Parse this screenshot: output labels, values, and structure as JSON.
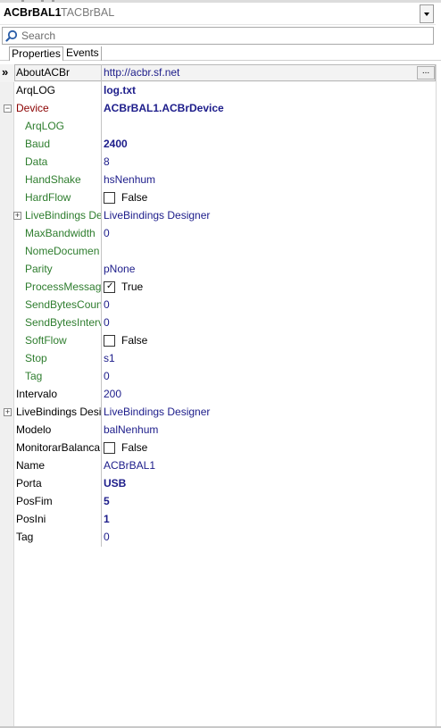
{
  "component": {
    "name": "ACBrBAL1",
    "type": "TACBrBAL"
  },
  "search": {
    "placeholder": "Search"
  },
  "tabs": {
    "properties": "Properties",
    "events": "Events"
  },
  "properties": {
    "about": {
      "name": "AboutACBr",
      "value": "http://acbr.sf.net"
    },
    "arqlog": {
      "name": "ArqLOG",
      "value": "log.txt"
    },
    "device": {
      "name": "Device",
      "value": "ACBrBAL1.ACBrDevice"
    },
    "dev_arqlog": {
      "name": "ArqLOG",
      "value": ""
    },
    "dev_baud": {
      "name": "Baud",
      "value": "2400"
    },
    "dev_data": {
      "name": "Data",
      "value": "8"
    },
    "dev_handshake": {
      "name": "HandShake",
      "value": "hsNenhum"
    },
    "dev_hardflow": {
      "name": "HardFlow",
      "value": "False",
      "checked": false
    },
    "dev_livebindings": {
      "name": "LiveBindings De",
      "value": "LiveBindings Designer"
    },
    "dev_maxbandwidth": {
      "name": "MaxBandwidth",
      "value": "0"
    },
    "dev_nomedocumento": {
      "name": "NomeDocumen",
      "value": ""
    },
    "dev_parity": {
      "name": "Parity",
      "value": "pNone"
    },
    "dev_processmessages": {
      "name": "ProcessMessage",
      "value": "True",
      "checked": true
    },
    "dev_sendbytescount": {
      "name": "SendBytesCount",
      "value": "0"
    },
    "dev_sendbytesinterval": {
      "name": "SendBytesInterv",
      "value": "0"
    },
    "dev_softflow": {
      "name": "SoftFlow",
      "value": "False",
      "checked": false
    },
    "dev_stop": {
      "name": "Stop",
      "value": "s1"
    },
    "dev_tag": {
      "name": "Tag",
      "value": "0"
    },
    "intervalo": {
      "name": "Intervalo",
      "value": "200"
    },
    "livebindings": {
      "name": "LiveBindings Desig",
      "value": "LiveBindings Designer"
    },
    "modelo": {
      "name": "Modelo",
      "value": "balNenhum"
    },
    "monitorar": {
      "name": "MonitorarBalanca",
      "value": "False",
      "checked": false
    },
    "name": {
      "name": "Name",
      "value": "ACBrBAL1"
    },
    "porta": {
      "name": "Porta",
      "value": "USB"
    },
    "posfim": {
      "name": "PosFim",
      "value": "5"
    },
    "posini": {
      "name": "PosIni",
      "value": "1"
    },
    "tag": {
      "name": "Tag",
      "value": "0"
    }
  },
  "icons": {
    "selected_marker": "»",
    "collapse": "−",
    "expand": "+",
    "ellipsis": "...",
    "checkmark": "✓"
  }
}
